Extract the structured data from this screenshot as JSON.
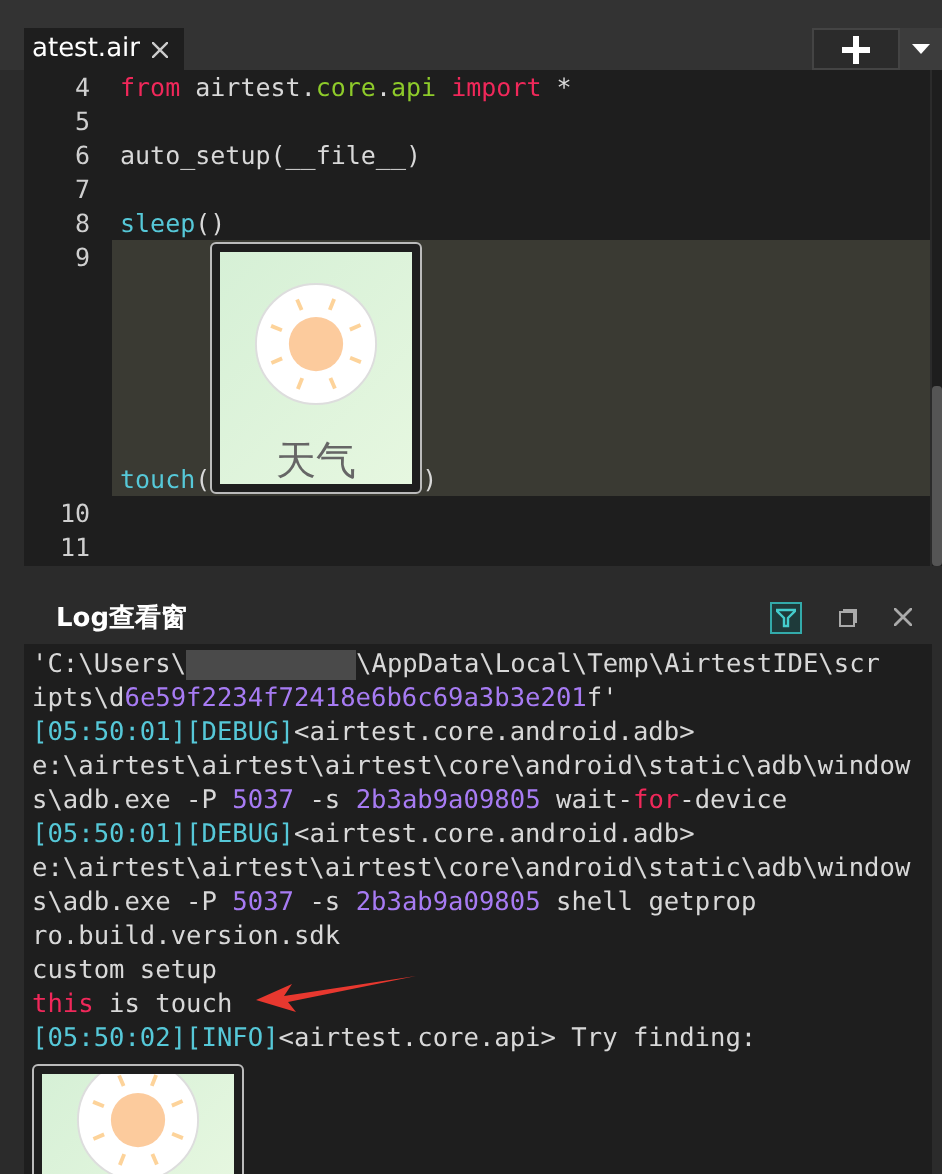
{
  "editor": {
    "tab": {
      "label": "atest.air",
      "selected": true
    },
    "lines": [
      {
        "number": "4",
        "kind": "code",
        "tokens": [
          {
            "text": "from",
            "kind": "keyword"
          },
          {
            "text": " airtest.",
            "kind": "plain"
          },
          {
            "text": "core",
            "kind": "module"
          },
          {
            "text": ".",
            "kind": "plain"
          },
          {
            "text": "api",
            "kind": "module"
          },
          {
            "text": " import",
            "kind": "keyword"
          },
          {
            "text": " *",
            "kind": "plain"
          }
        ]
      },
      {
        "number": "5",
        "kind": "code"
      },
      {
        "number": "6",
        "kind": "code",
        "tokens": [
          {
            "text": "auto_setup(__file__)",
            "kind": "plain"
          }
        ]
      },
      {
        "number": "7",
        "kind": "code"
      },
      {
        "number": "8",
        "kind": "code",
        "tokens": [
          {
            "text": "sleep",
            "kind": "function"
          },
          {
            "text": "()",
            "kind": "plain"
          }
        ]
      },
      {
        "number": "9",
        "kind": "image",
        "tokens": [
          {
            "text": "touch",
            "kind": "function"
          },
          {
            "text": "(",
            "kind": "plain"
          },
          {
            "text": "天气",
            "kind": "image"
          },
          {
            "text": ")",
            "kind": "plain"
          }
        ]
      },
      {
        "number": "10",
        "kind": "code"
      },
      {
        "number": "11",
        "kind": "code"
      }
    ]
  },
  "log": {
    "title": "Log查看窗",
    "lines": [
      {
        "kind": "text",
        "tokens": [
          {
            "text": "'C:\\Users\\",
            "kind": "plain"
          },
          {
            "kind": "redacted"
          },
          {
            "text": "\\AppData\\Local\\Temp\\AirtestIDE\\scr",
            "kind": "plain"
          }
        ]
      },
      {
        "kind": "text",
        "tokens": [
          {
            "text": "ipts\\d",
            "kind": "plain"
          },
          {
            "text": "6e59f2234f72418e6b6c69a3b3e201",
            "kind": "number"
          },
          {
            "text": "f'",
            "kind": "plain"
          }
        ]
      },
      {
        "kind": "text",
        "tokens": [
          {
            "text": "[05:50:01][DEBUG]",
            "kind": "bracket"
          },
          {
            "text": "<airtest.core.android.adb>",
            "kind": "plain"
          }
        ]
      },
      {
        "kind": "text",
        "tokens": [
          {
            "text": "e:\\airtest\\airtest\\airtest\\core\\android\\static\\adb\\window",
            "kind": "plain"
          }
        ]
      },
      {
        "kind": "text",
        "tokens": [
          {
            "text": "s\\adb.exe -P ",
            "kind": "plain"
          },
          {
            "text": "5037",
            "kind": "number"
          },
          {
            "text": " -s ",
            "kind": "plain"
          },
          {
            "text": "2b3ab9a09805",
            "kind": "number"
          },
          {
            "text": " wait-",
            "kind": "plain"
          },
          {
            "text": "for",
            "kind": "keyword"
          },
          {
            "text": "-device",
            "kind": "plain"
          }
        ]
      },
      {
        "kind": "text",
        "tokens": [
          {
            "text": "[05:50:01][DEBUG]",
            "kind": "bracket"
          },
          {
            "text": "<airtest.core.android.adb>",
            "kind": "plain"
          }
        ]
      },
      {
        "kind": "text",
        "tokens": [
          {
            "text": "e:\\airtest\\airtest\\airtest\\core\\android\\static\\adb\\window",
            "kind": "plain"
          }
        ]
      },
      {
        "kind": "text",
        "tokens": [
          {
            "text": "s\\adb.exe -P ",
            "kind": "plain"
          },
          {
            "text": "5037",
            "kind": "number"
          },
          {
            "text": " -s ",
            "kind": "plain"
          },
          {
            "text": "2b3ab9a09805",
            "kind": "number"
          },
          {
            "text": " shell getprop",
            "kind": "plain"
          }
        ]
      },
      {
        "kind": "text",
        "tokens": [
          {
            "text": "ro.build.version.sdk",
            "kind": "plain"
          }
        ]
      },
      {
        "kind": "text",
        "tokens": [
          {
            "text": "custom setup",
            "kind": "plain"
          }
        ]
      },
      {
        "kind": "text",
        "arrow": true,
        "tokens": [
          {
            "text": "this",
            "kind": "keyword"
          },
          {
            "text": " is touch",
            "kind": "plain"
          }
        ]
      },
      {
        "kind": "text",
        "tokens": [
          {
            "text": "[05:50:02][INFO]",
            "kind": "bracket"
          },
          {
            "text": "<airtest.core.api> Try finding:",
            "kind": "plain"
          }
        ]
      },
      {
        "kind": "image"
      }
    ]
  }
}
